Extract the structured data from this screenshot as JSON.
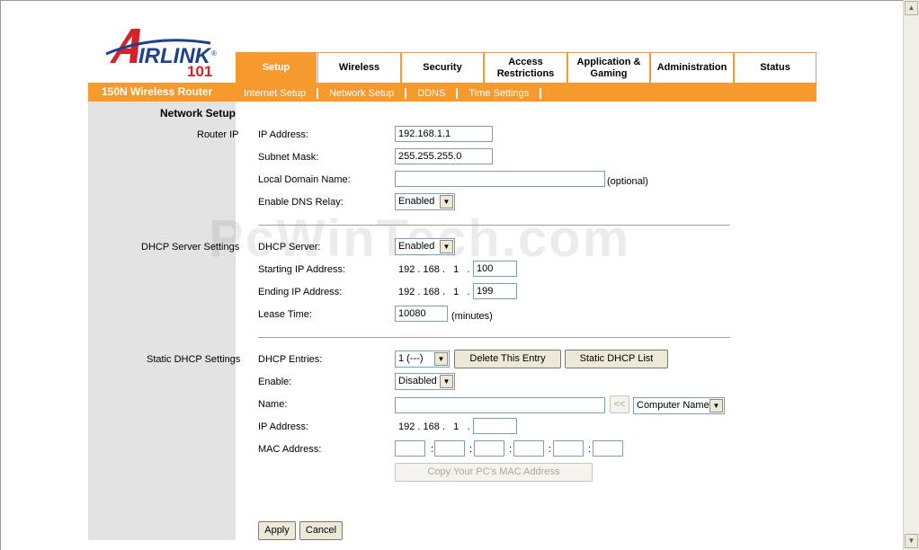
{
  "brand_sub": "150N Wireless Router",
  "logo": {
    "word": "IRLINK",
    "initial": "A",
    "number": "101",
    "reg": "®"
  },
  "tabs": [
    {
      "l1": "Setup",
      "l2": ""
    },
    {
      "l1": "Wireless",
      "l2": ""
    },
    {
      "l1": "Security",
      "l2": ""
    },
    {
      "l1": "Access",
      "l2": "Restrictions"
    },
    {
      "l1": "Application &",
      "l2": "Gaming"
    },
    {
      "l1": "Administration",
      "l2": ""
    },
    {
      "l1": "Status",
      "l2": ""
    }
  ],
  "subnav": [
    "Internet Setup",
    "Network Setup",
    "DDNS",
    "Time Settings"
  ],
  "sections": {
    "network_setup": "Network Setup",
    "router_ip": "Router IP",
    "dhcp_server": "DHCP Server Settings",
    "static_dhcp": "Static DHCP Settings"
  },
  "router": {
    "ip_label": "IP Address:",
    "ip_value": "192.168.1.1",
    "mask_label": "Subnet Mask:",
    "mask_value": "255.255.255.0",
    "domain_label": "Local Domain Name:",
    "domain_value": "",
    "optional": "(optional)",
    "dns_relay_label": "Enable DNS Relay:",
    "dns_relay_value": "Enabled"
  },
  "dhcp": {
    "server_label": "DHCP Server:",
    "server_value": "Enabled",
    "start_label": "Starting IP Address:",
    "start_prefix": [
      "192",
      "168",
      "1"
    ],
    "start_last": "100",
    "end_label": "Ending IP Address:",
    "end_prefix": [
      "192",
      "168",
      "1"
    ],
    "end_last": "199",
    "lease_label": "Lease Time:",
    "lease_value": "10080",
    "lease_unit": "(minutes)"
  },
  "static": {
    "entries_label": "DHCP Entries:",
    "entries_value": "1 (---)",
    "delete_btn": "Delete This Entry",
    "list_btn": "Static DHCP List",
    "enable_label": "Enable:",
    "enable_value": "Disabled",
    "name_label": "Name:",
    "name_value": "",
    "copy_name_btn": "<<",
    "computer_name": "Computer Name",
    "ip_label": "IP Address:",
    "ip_prefix": [
      "192",
      "168",
      "1"
    ],
    "ip_last": "",
    "mac_label": "MAC Address:",
    "copy_mac_btn": "Copy Your PC's MAC Address"
  },
  "actions": {
    "apply": "Apply",
    "cancel": "Cancel"
  },
  "watermark": "PcWinTech.com",
  "colors": {
    "accent": "#f79a2e",
    "logo_red": "#d6202a",
    "logo_blue": "#1f3f8f"
  }
}
